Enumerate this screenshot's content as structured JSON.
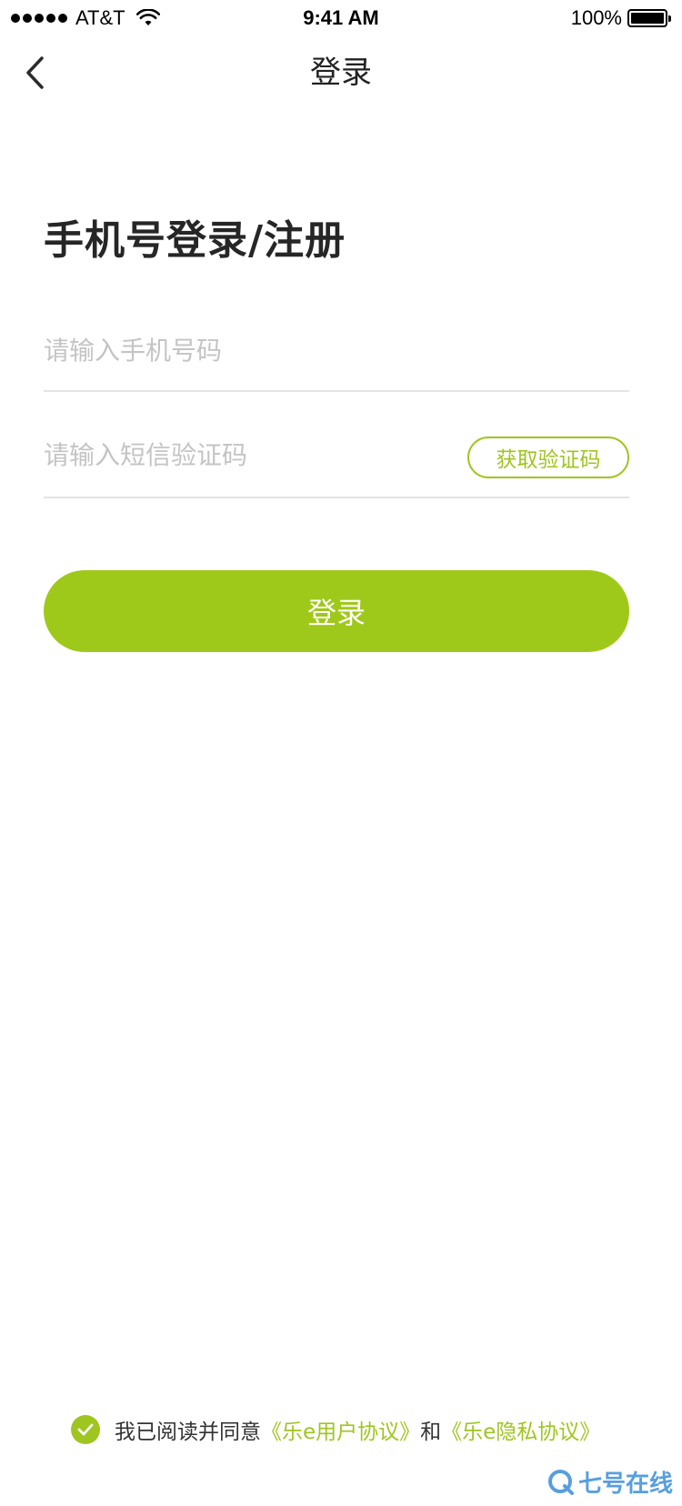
{
  "status_bar": {
    "carrier": "AT&T",
    "time": "9:41 AM",
    "battery": "100%"
  },
  "nav": {
    "title": "登录",
    "back_icon": "chevron-left-icon"
  },
  "heading": "手机号登录/注册",
  "phone_input": {
    "value": "",
    "placeholder": "请输入手机号码"
  },
  "sms_input": {
    "value": "",
    "placeholder": "请输入短信验证码"
  },
  "get_code_label": "获取验证码",
  "login_label": "登录",
  "agreement": {
    "prefix": "我已阅读并同意",
    "user_agreement": "《乐e用户协议》",
    "conjunction": "和",
    "privacy_agreement": "《乐e隐私协议》",
    "checked": true
  },
  "watermark": {
    "text": "七号在线"
  },
  "colors": {
    "accent": "#9fc520",
    "button": "#9fc91a",
    "placeholder": "#c4c4c4",
    "divider": "#e4e4e4"
  }
}
